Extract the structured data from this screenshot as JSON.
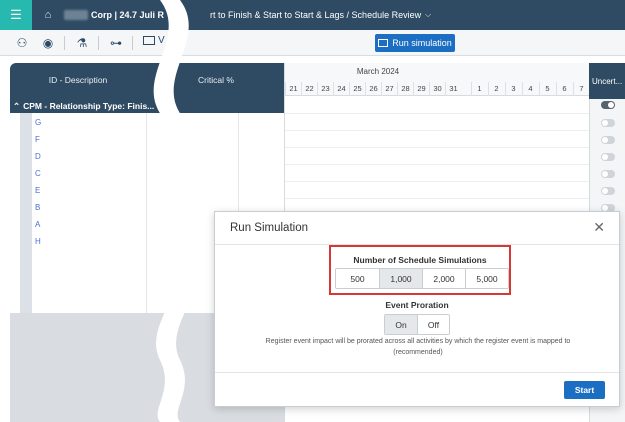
{
  "header": {
    "menu_icon": "hamburger-icon",
    "home_icon": "home-icon",
    "breadcrumb_left": "Corp | 24.7 Juli R",
    "breadcrumb_right": "rt to Finish & Start to Start & Lags / Schedule Review"
  },
  "toolbar": {
    "icons": [
      "relationship-icon",
      "eye-icon",
      "filter-icon",
      "hierarchy-icon",
      "view-icon"
    ],
    "view_label": "V",
    "run_simulation_label": "Run simulation"
  },
  "grid": {
    "columns": {
      "id_description": "ID - Description",
      "critical": "Critical %",
      "uncertainty": "Uncert..."
    },
    "group_row": "CPM - Relationship Type: Finis...",
    "rows": [
      "G",
      "F",
      "D",
      "C",
      "E",
      "B",
      "A",
      "H"
    ]
  },
  "timeline": {
    "month": "March 2024",
    "days": [
      "21",
      "22",
      "23",
      "24",
      "25",
      "26",
      "27",
      "28",
      "29",
      "30",
      "31",
      "1",
      "2",
      "3",
      "4",
      "5",
      "6",
      "7"
    ]
  },
  "modal": {
    "title": "Run Simulation",
    "close_icon": "close-icon",
    "simulations_label": "Number of Schedule Simulations",
    "simulation_options": [
      "500",
      "1,000",
      "2,000",
      "5,000"
    ],
    "selected_simulation": "1,000",
    "event_proration_label": "Event Proration",
    "proration_options": [
      "On",
      "Off"
    ],
    "selected_proration": "On",
    "description": "Register event impact will be prorated across all activities by which the register event is mapped to (recommended)",
    "start_label": "Start"
  },
  "colors": {
    "header_bg": "#2f4b63",
    "accent_teal": "#27b8b0",
    "primary_blue": "#1b6ec2",
    "highlight_red": "#d93636",
    "row_link": "#4a6fd0"
  }
}
